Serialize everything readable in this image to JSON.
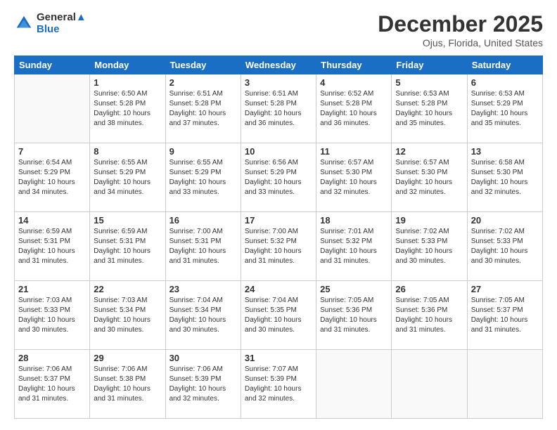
{
  "header": {
    "logo_line1": "General",
    "logo_line2": "Blue",
    "month": "December 2025",
    "location": "Ojus, Florida, United States"
  },
  "weekdays": [
    "Sunday",
    "Monday",
    "Tuesday",
    "Wednesday",
    "Thursday",
    "Friday",
    "Saturday"
  ],
  "weeks": [
    [
      {
        "day": "",
        "info": ""
      },
      {
        "day": "1",
        "info": "Sunrise: 6:50 AM\nSunset: 5:28 PM\nDaylight: 10 hours\nand 38 minutes."
      },
      {
        "day": "2",
        "info": "Sunrise: 6:51 AM\nSunset: 5:28 PM\nDaylight: 10 hours\nand 37 minutes."
      },
      {
        "day": "3",
        "info": "Sunrise: 6:51 AM\nSunset: 5:28 PM\nDaylight: 10 hours\nand 36 minutes."
      },
      {
        "day": "4",
        "info": "Sunrise: 6:52 AM\nSunset: 5:28 PM\nDaylight: 10 hours\nand 36 minutes."
      },
      {
        "day": "5",
        "info": "Sunrise: 6:53 AM\nSunset: 5:28 PM\nDaylight: 10 hours\nand 35 minutes."
      },
      {
        "day": "6",
        "info": "Sunrise: 6:53 AM\nSunset: 5:29 PM\nDaylight: 10 hours\nand 35 minutes."
      }
    ],
    [
      {
        "day": "7",
        "info": "Sunrise: 6:54 AM\nSunset: 5:29 PM\nDaylight: 10 hours\nand 34 minutes."
      },
      {
        "day": "8",
        "info": "Sunrise: 6:55 AM\nSunset: 5:29 PM\nDaylight: 10 hours\nand 34 minutes."
      },
      {
        "day": "9",
        "info": "Sunrise: 6:55 AM\nSunset: 5:29 PM\nDaylight: 10 hours\nand 33 minutes."
      },
      {
        "day": "10",
        "info": "Sunrise: 6:56 AM\nSunset: 5:29 PM\nDaylight: 10 hours\nand 33 minutes."
      },
      {
        "day": "11",
        "info": "Sunrise: 6:57 AM\nSunset: 5:30 PM\nDaylight: 10 hours\nand 32 minutes."
      },
      {
        "day": "12",
        "info": "Sunrise: 6:57 AM\nSunset: 5:30 PM\nDaylight: 10 hours\nand 32 minutes."
      },
      {
        "day": "13",
        "info": "Sunrise: 6:58 AM\nSunset: 5:30 PM\nDaylight: 10 hours\nand 32 minutes."
      }
    ],
    [
      {
        "day": "14",
        "info": "Sunrise: 6:59 AM\nSunset: 5:31 PM\nDaylight: 10 hours\nand 31 minutes."
      },
      {
        "day": "15",
        "info": "Sunrise: 6:59 AM\nSunset: 5:31 PM\nDaylight: 10 hours\nand 31 minutes."
      },
      {
        "day": "16",
        "info": "Sunrise: 7:00 AM\nSunset: 5:31 PM\nDaylight: 10 hours\nand 31 minutes."
      },
      {
        "day": "17",
        "info": "Sunrise: 7:00 AM\nSunset: 5:32 PM\nDaylight: 10 hours\nand 31 minutes."
      },
      {
        "day": "18",
        "info": "Sunrise: 7:01 AM\nSunset: 5:32 PM\nDaylight: 10 hours\nand 31 minutes."
      },
      {
        "day": "19",
        "info": "Sunrise: 7:02 AM\nSunset: 5:33 PM\nDaylight: 10 hours\nand 30 minutes."
      },
      {
        "day": "20",
        "info": "Sunrise: 7:02 AM\nSunset: 5:33 PM\nDaylight: 10 hours\nand 30 minutes."
      }
    ],
    [
      {
        "day": "21",
        "info": "Sunrise: 7:03 AM\nSunset: 5:33 PM\nDaylight: 10 hours\nand 30 minutes."
      },
      {
        "day": "22",
        "info": "Sunrise: 7:03 AM\nSunset: 5:34 PM\nDaylight: 10 hours\nand 30 minutes."
      },
      {
        "day": "23",
        "info": "Sunrise: 7:04 AM\nSunset: 5:34 PM\nDaylight: 10 hours\nand 30 minutes."
      },
      {
        "day": "24",
        "info": "Sunrise: 7:04 AM\nSunset: 5:35 PM\nDaylight: 10 hours\nand 30 minutes."
      },
      {
        "day": "25",
        "info": "Sunrise: 7:05 AM\nSunset: 5:36 PM\nDaylight: 10 hours\nand 31 minutes."
      },
      {
        "day": "26",
        "info": "Sunrise: 7:05 AM\nSunset: 5:36 PM\nDaylight: 10 hours\nand 31 minutes."
      },
      {
        "day": "27",
        "info": "Sunrise: 7:05 AM\nSunset: 5:37 PM\nDaylight: 10 hours\nand 31 minutes."
      }
    ],
    [
      {
        "day": "28",
        "info": "Sunrise: 7:06 AM\nSunset: 5:37 PM\nDaylight: 10 hours\nand 31 minutes."
      },
      {
        "day": "29",
        "info": "Sunrise: 7:06 AM\nSunset: 5:38 PM\nDaylight: 10 hours\nand 31 minutes."
      },
      {
        "day": "30",
        "info": "Sunrise: 7:06 AM\nSunset: 5:39 PM\nDaylight: 10 hours\nand 32 minutes."
      },
      {
        "day": "31",
        "info": "Sunrise: 7:07 AM\nSunset: 5:39 PM\nDaylight: 10 hours\nand 32 minutes."
      },
      {
        "day": "",
        "info": ""
      },
      {
        "day": "",
        "info": ""
      },
      {
        "day": "",
        "info": ""
      }
    ]
  ]
}
